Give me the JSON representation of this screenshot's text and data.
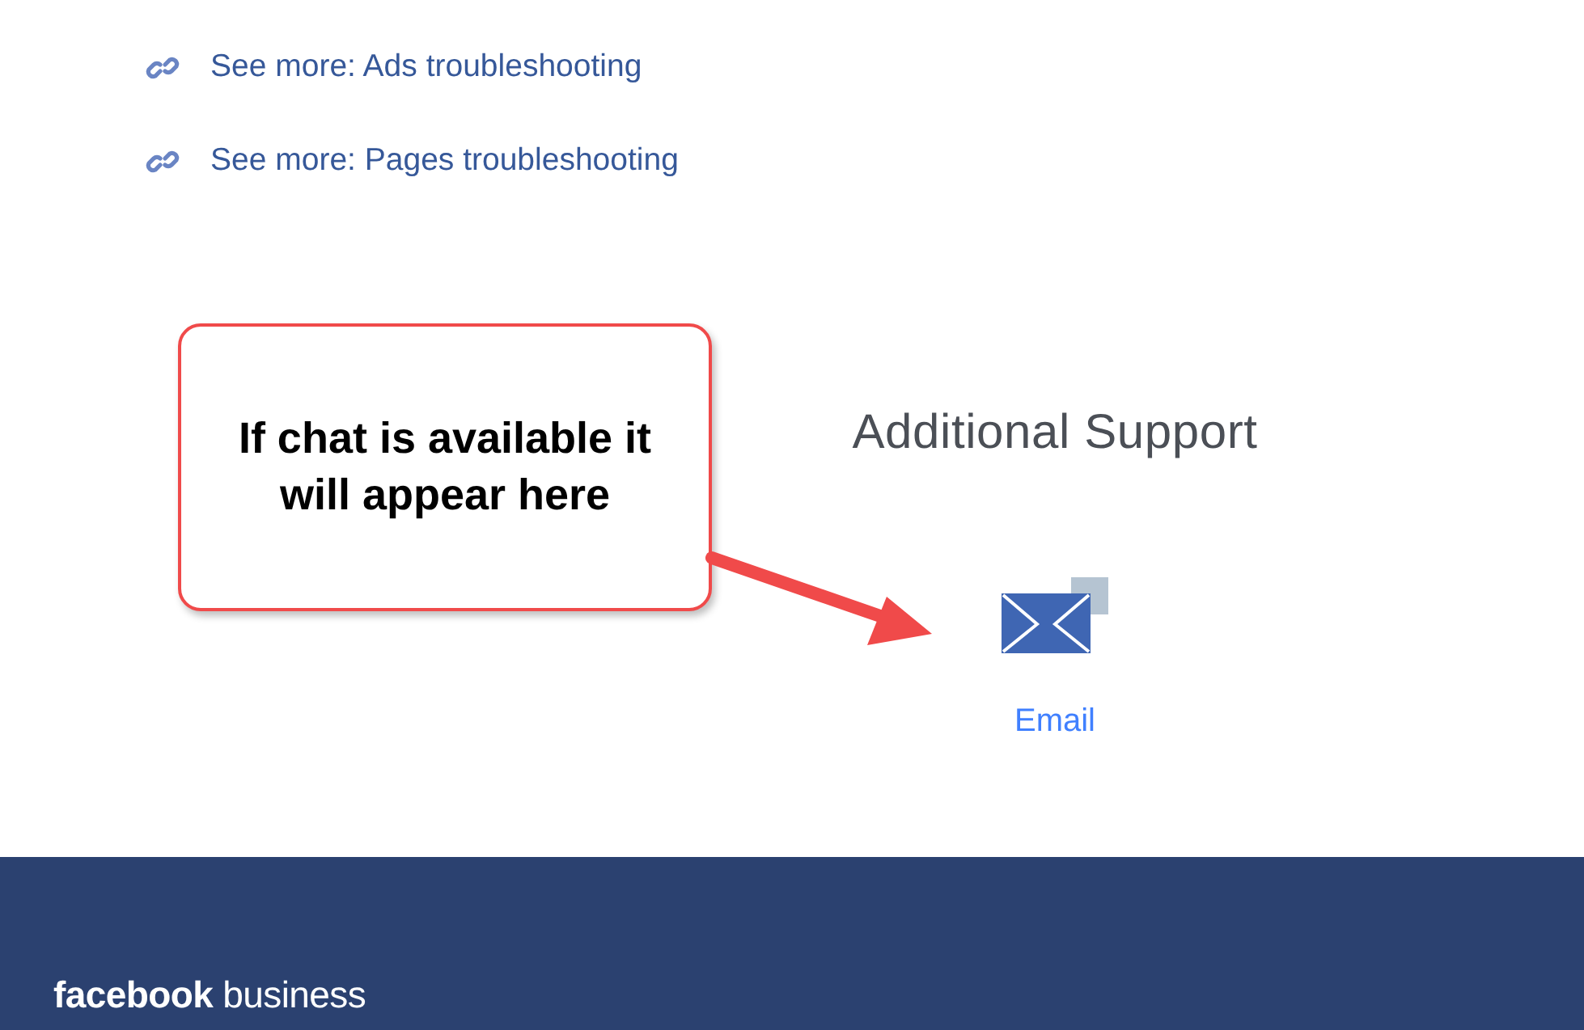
{
  "links": [
    {
      "label": "See more: Ads troubleshooting"
    },
    {
      "label": "See more: Pages troubleshooting"
    }
  ],
  "support": {
    "title": "Additional Support",
    "options": [
      {
        "label": "Email"
      }
    ]
  },
  "callout": {
    "text": "If chat is available it will appear here"
  },
  "footer": {
    "logo": "**facebook** business"
  }
}
